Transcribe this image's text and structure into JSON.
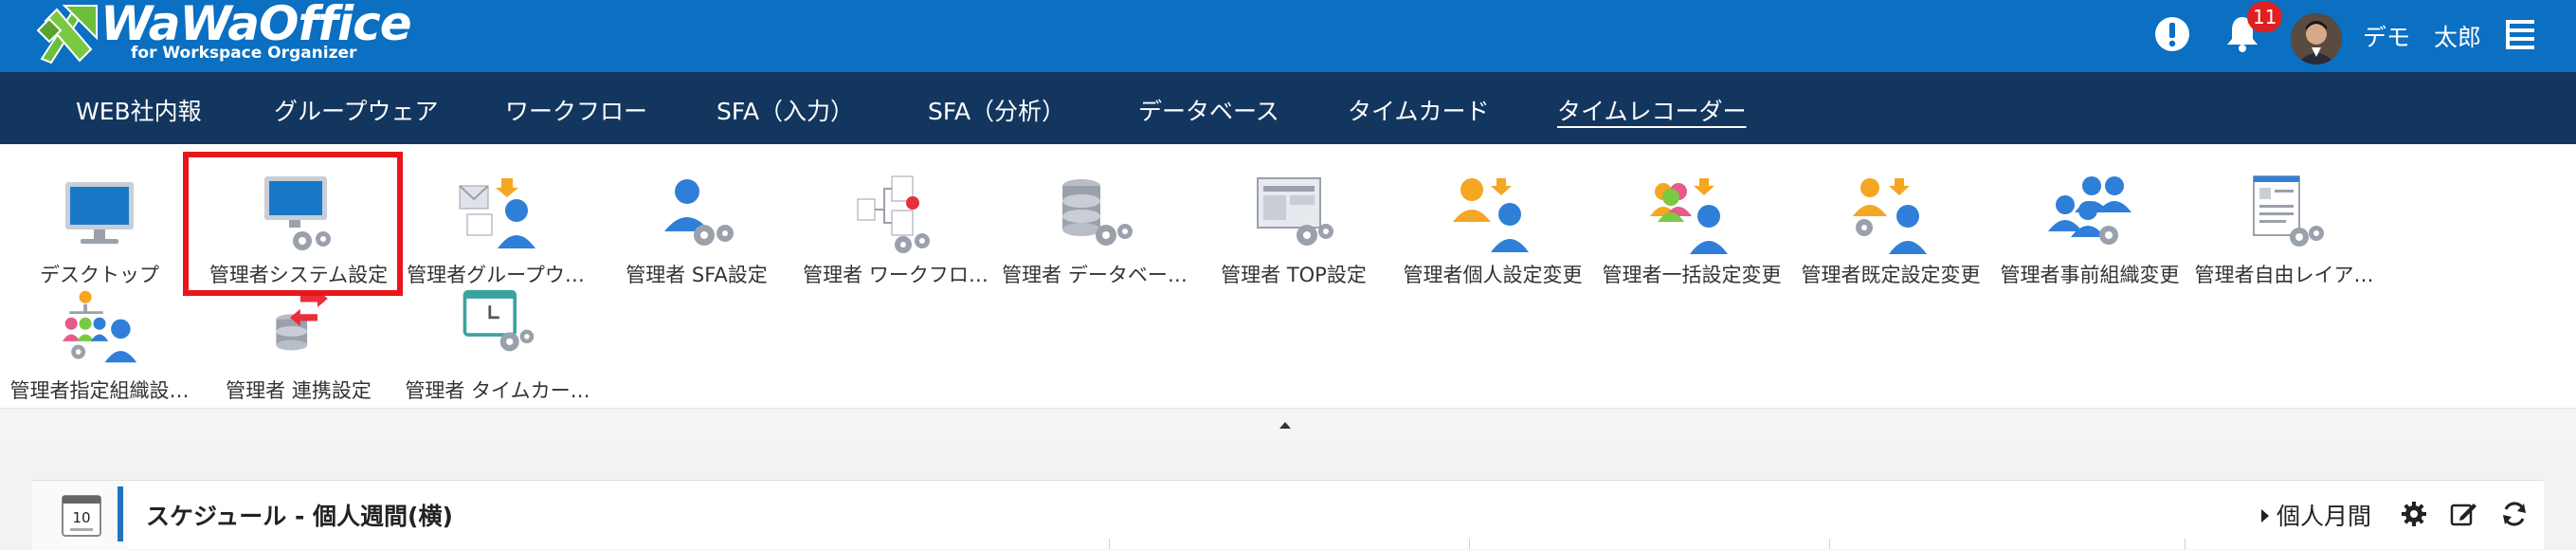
{
  "header": {
    "logo_title": "WaWaOffice",
    "logo_subtitle": "for Workspace Organizer",
    "notification_count": "11",
    "user_name": "デモ　太郎",
    "brand_color": "#0b6fc2"
  },
  "nav": {
    "items": [
      {
        "label": "WEB社内報"
      },
      {
        "label": "グループウェア"
      },
      {
        "label": "ワークフロー"
      },
      {
        "label": "SFA（入力）"
      },
      {
        "label": "SFA（分析）"
      },
      {
        "label": "データベース"
      },
      {
        "label": "タイムカード"
      },
      {
        "label": "タイムレコーダー",
        "active": true
      }
    ]
  },
  "panel": {
    "row1": [
      {
        "label": "デスクトップ",
        "icon": "monitor-icon"
      },
      {
        "label": "管理者システム設定",
        "icon": "monitor-gear-icon",
        "highlighted": true
      },
      {
        "label": "管理者グループウ…",
        "icon": "groupware-admin-icon"
      },
      {
        "label": "管理者 SFA設定",
        "icon": "sfa-admin-icon"
      },
      {
        "label": "管理者 ワークフロ…",
        "icon": "workflow-admin-icon"
      },
      {
        "label": "管理者 データベー…",
        "icon": "database-admin-icon"
      },
      {
        "label": "管理者 TOP設定",
        "icon": "top-settings-icon"
      },
      {
        "label": "管理者個人設定変更",
        "icon": "personal-settings-icon"
      },
      {
        "label": "管理者一括設定変更",
        "icon": "bulk-settings-icon"
      },
      {
        "label": "管理者既定設定変更",
        "icon": "default-settings-icon"
      },
      {
        "label": "管理者事前組織変更",
        "icon": "org-change-icon"
      },
      {
        "label": "管理者自由レイア…",
        "icon": "free-layout-icon"
      }
    ],
    "row2": [
      {
        "label": "管理者指定組織設…",
        "icon": "org-designate-icon"
      },
      {
        "label": "管理者 連携設定",
        "icon": "integration-icon"
      },
      {
        "label": "管理者 タイムカー…",
        "icon": "timecard-admin-icon"
      }
    ]
  },
  "schedule": {
    "calendar_day": "10",
    "title": "スケジュール - 個人週間(横)",
    "monthly_link": "個人月間"
  }
}
